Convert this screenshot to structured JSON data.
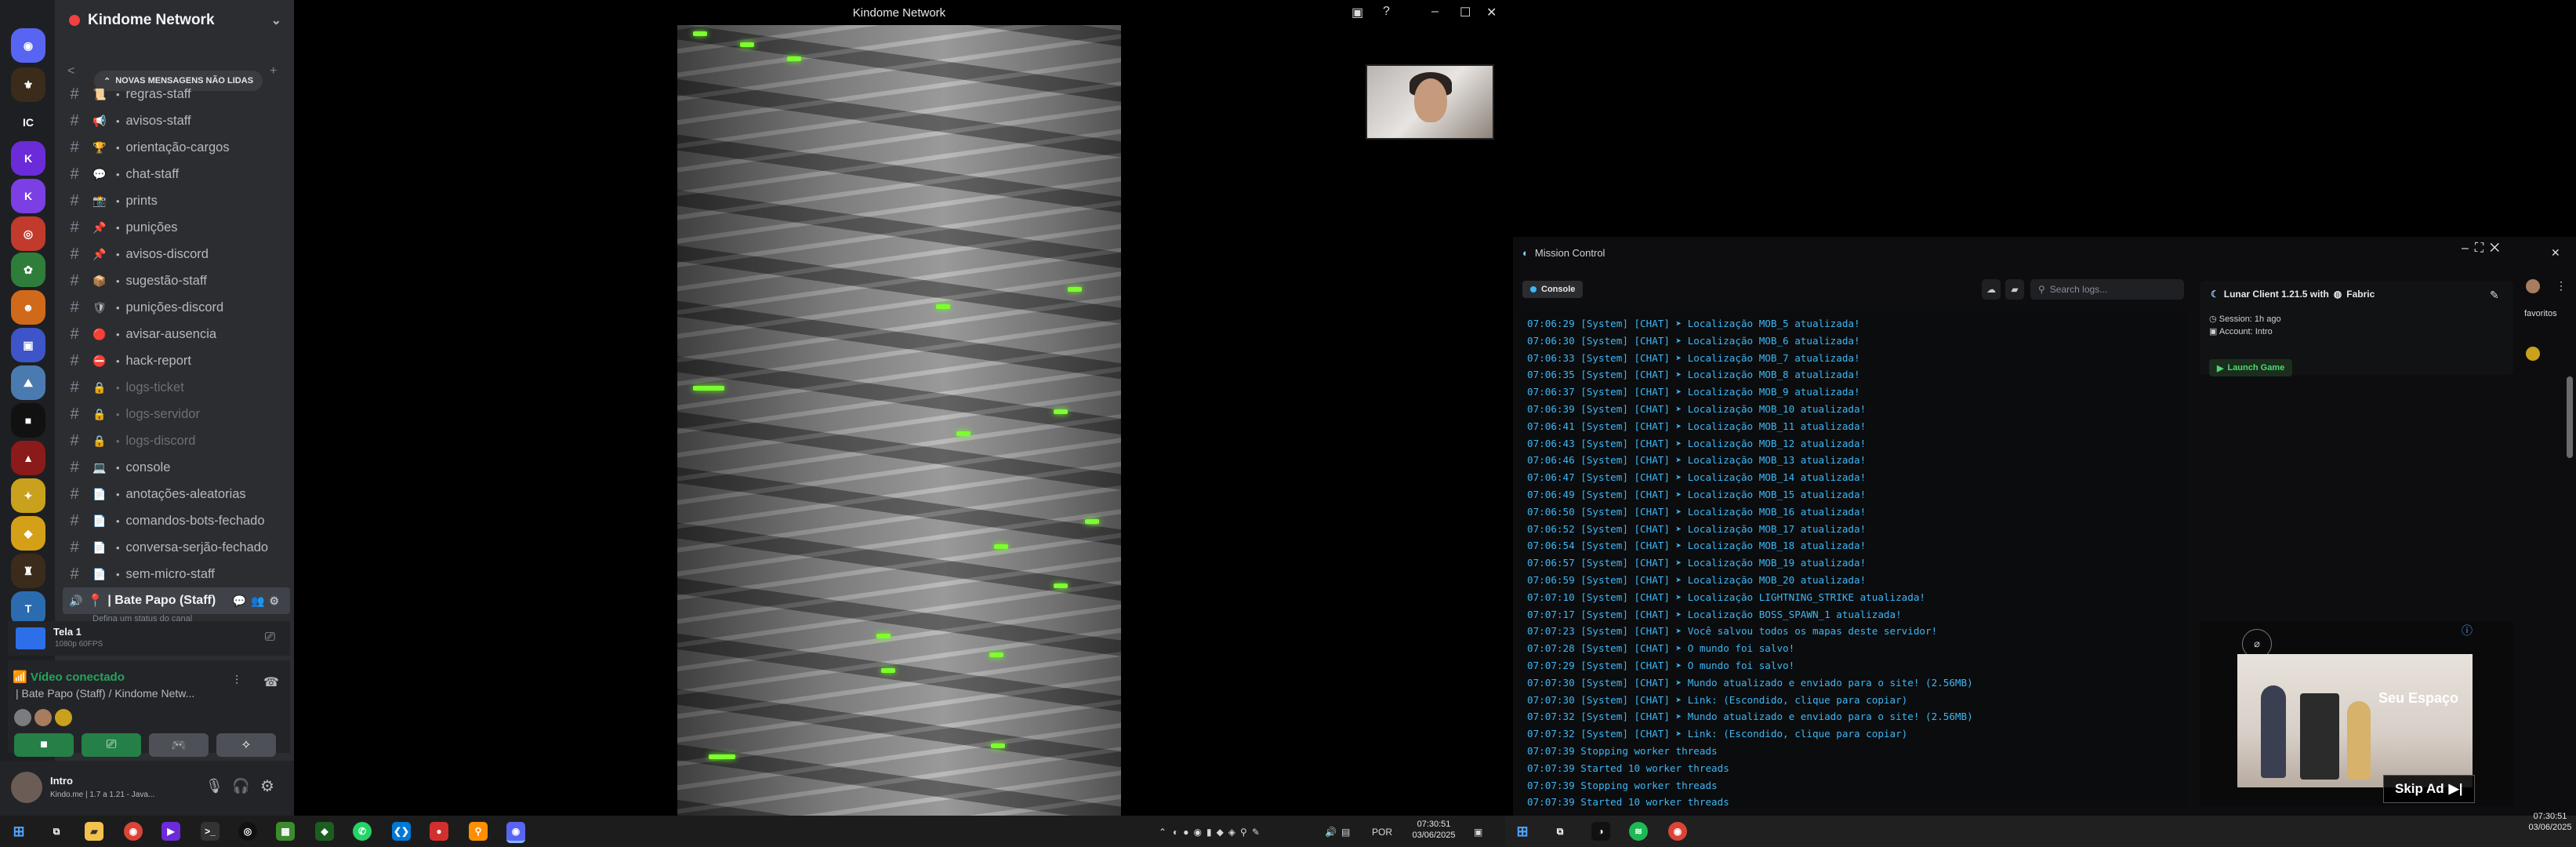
{
  "discord": {
    "server_name": "Kindome Network",
    "new_messages": "NOVAS MENSAGENS NÃO LIDAS",
    "channels": [
      {
        "emoji": "📜",
        "name": "regras-staff",
        "locked": false
      },
      {
        "emoji": "📢",
        "name": "avisos-staff",
        "locked": false
      },
      {
        "emoji": "🏆",
        "name": "orientação-cargos",
        "locked": false
      },
      {
        "emoji": "💬",
        "name": "chat-staff",
        "locked": false
      },
      {
        "emoji": "📸",
        "name": "prints",
        "locked": false
      },
      {
        "emoji": "📌",
        "name": "punições",
        "locked": false
      },
      {
        "emoji": "📌",
        "name": "avisos-discord",
        "locked": false
      },
      {
        "emoji": "📦",
        "name": "sugestão-staff",
        "locked": false
      },
      {
        "emoji": "🛡",
        "name": "punições-discord",
        "locked": false
      },
      {
        "emoji": "🔴",
        "name": "avisar-ausencia",
        "locked": false
      },
      {
        "emoji": "⛔",
        "name": "hack-report",
        "locked": false
      },
      {
        "emoji": "🔒",
        "name": "logs-ticket",
        "locked": true
      },
      {
        "emoji": "🔒",
        "name": "logs-servidor",
        "locked": true
      },
      {
        "emoji": "🔒",
        "name": "logs-discord",
        "locked": true
      },
      {
        "emoji": "💻",
        "name": "console",
        "locked": false
      },
      {
        "emoji": "📄",
        "name": "anotações-aleatorias",
        "locked": false
      },
      {
        "emoji": "📄",
        "name": "comandos-bots-fechado",
        "locked": false
      },
      {
        "emoji": "📄",
        "name": "conversa-serjão-fechado",
        "locked": false
      },
      {
        "emoji": "📄",
        "name": "sem-micro-staff",
        "locked": false
      }
    ],
    "active_channel": "| Bate Papo (Staff)",
    "active_channel_sub": "Defina um status do canal",
    "stream_title": "Tela 1",
    "stream_quality": "1080p 60FPS",
    "voice_status": "Vídeo conectado",
    "voice_location": "| Bate Papo (Staff) / Kindome Netw...",
    "user_name": "Intro",
    "user_status": "Kindo.me | 1.7 a 1.21 - Java..."
  },
  "video": {
    "window_title": "Kindome Network"
  },
  "mission_control": {
    "title": "Mission Control",
    "tab_console": "Console",
    "search_placeholder": "Search logs...",
    "client_name": "Lunar Client 1.21.5 with",
    "loader": "Fabric",
    "session": "Session: 1h ago",
    "account": "Account: Intro",
    "launch": "Launch Game",
    "ad_brand": "Seu Espaço",
    "skip_ad": "Skip Ad",
    "favorites": "favoritos",
    "log_lines": [
      "07:06:29 [System] [CHAT] ➤ Localização MOB_5 atualizada!",
      "07:06:30 [System] [CHAT] ➤ Localização MOB_6 atualizada!",
      "07:06:33 [System] [CHAT] ➤ Localização MOB_7 atualizada!",
      "07:06:35 [System] [CHAT] ➤ Localização MOB_8 atualizada!",
      "07:06:37 [System] [CHAT] ➤ Localização MOB_9 atualizada!",
      "07:06:39 [System] [CHAT] ➤ Localização MOB_10 atualizada!",
      "07:06:41 [System] [CHAT] ➤ Localização MOB_11 atualizada!",
      "07:06:43 [System] [CHAT] ➤ Localização MOB_12 atualizada!",
      "07:06:46 [System] [CHAT] ➤ Localização MOB_13 atualizada!",
      "07:06:47 [System] [CHAT] ➤ Localização MOB_14 atualizada!",
      "07:06:49 [System] [CHAT] ➤ Localização MOB_15 atualizada!",
      "07:06:50 [System] [CHAT] ➤ Localização MOB_16 atualizada!",
      "07:06:52 [System] [CHAT] ➤ Localização MOB_17 atualizada!",
      "07:06:54 [System] [CHAT] ➤ Localização MOB_18 atualizada!",
      "07:06:57 [System] [CHAT] ➤ Localização MOB_19 atualizada!",
      "07:06:59 [System] [CHAT] ➤ Localização MOB_20 atualizada!",
      "07:07:10 [System] [CHAT] ➤ Localização LIGHTNING_STRIKE atualizada!",
      "07:07:17 [System] [CHAT] ➤ Localização BOSS_SPAWN_1 atualizada!",
      "07:07:23 [System] [CHAT] ➤ Você salvou todos os mapas deste servidor!",
      "07:07:28 [System] [CHAT] ➤ O mundo foi salvo!",
      "07:07:29 [System] [CHAT] ➤ O mundo foi salvo!",
      "07:07:30 [System] [CHAT] ➤ Mundo atualizado e enviado para o site! (2.56MB)",
      "07:07:30 [System] [CHAT] ➤ Link: (Escondido, clique para copiar)",
      "07:07:32 [System] [CHAT] ➤ Mundo atualizado e enviado para o site! (2.56MB)",
      "07:07:32 [System] [CHAT] ➤ Link: (Escondido, clique para copiar)",
      "07:07:39 Stopping worker threads",
      "07:07:39 Started 10 worker threads",
      "07:07:39 Stopping worker threads",
      "07:07:39 Started 10 worker threads"
    ]
  },
  "taskbar": {
    "left_lang": "POR",
    "left_time": "07:30:51",
    "left_date": "03/06/2025",
    "right_time": "07:30:51",
    "right_date": "03/06/2025"
  }
}
